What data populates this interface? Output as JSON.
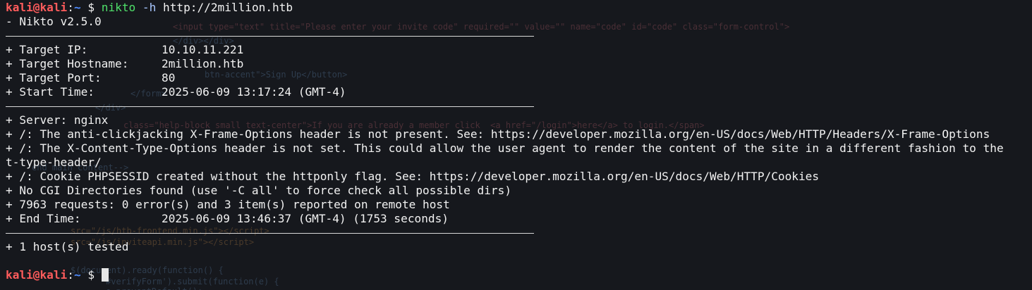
{
  "prompt": {
    "user": "kali",
    "at": "@",
    "host": "kali",
    "colon": ":",
    "path": "~",
    "dollar": "$"
  },
  "command": {
    "program": "nikto",
    "flag": "-h",
    "argument": "http://2million.htb"
  },
  "banner": "- Nikto v2.5.0",
  "target_info": [
    {
      "label": "+ Target IP:",
      "value": "10.10.11.221"
    },
    {
      "label": "+ Target Hostname:",
      "value": "2million.htb"
    },
    {
      "label": "+ Target Port:",
      "value": "80"
    },
    {
      "label": "+ Start Time:",
      "value": "2025-06-09 13:17:24 (GMT-4)"
    }
  ],
  "findings": [
    "+ Server: nginx",
    "+ /: The anti-clickjacking X-Frame-Options header is not present. See: https://developer.mozilla.org/en-US/docs/Web/HTTP/Headers/X-Frame-Options",
    "+ /: The X-Content-Type-Options header is not set. This could allow the user agent to render the content of the site in a different fashion to the",
    "t-type-header/",
    "+ /: Cookie PHPSESSID created without the httponly flag. See: https://developer.mozilla.org/en-US/docs/Web/HTTP/Cookies",
    "+ No CGI Directories found (use '-C all' to force check all possible dirs)",
    "+ 7963 requests: 0 error(s) and 3 item(s) reported on remote host"
  ],
  "end_time": {
    "label": "+ End Time:",
    "value": "2025-06-09 13:46:37 (GMT-4) (1753 seconds)"
  },
  "summary": "+ 1 host(s) tested",
  "colors": {
    "background": "#16181d",
    "prompt_user": "#ff5c5c",
    "prompt_path": "#4f8cff",
    "command": "#4fe06a",
    "text": "#f2f2f2"
  }
}
